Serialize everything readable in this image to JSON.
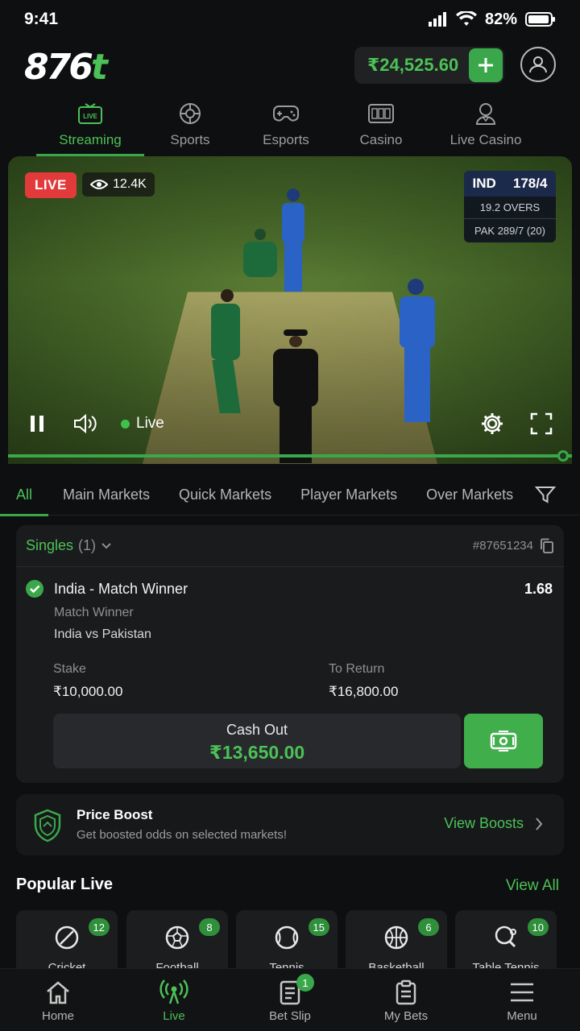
{
  "status_bar": {
    "time": "9:41",
    "battery": "82%"
  },
  "header": {
    "logo_main": "876",
    "logo_accent": "t",
    "balance": "₹24,525.60"
  },
  "top_tabs": [
    {
      "label": "Streaming",
      "icon": "live-tv-icon",
      "active": true
    },
    {
      "label": "Sports",
      "icon": "ball-icon"
    },
    {
      "label": "Esports",
      "icon": "gamepad-icon"
    },
    {
      "label": "Casino",
      "icon": "slot-machine-icon"
    },
    {
      "label": "Live Casino",
      "icon": "dealer-icon"
    }
  ],
  "video": {
    "live_badge": "LIVE",
    "viewers": "12.4K",
    "score": {
      "team": "IND",
      "runs": "178/4",
      "overs": "19.2 OVERS",
      "opponent": "PAK 289/7 (20)"
    },
    "live_label": "Live",
    "progress": 0.98
  },
  "market_tabs": [
    "All",
    "Main Markets",
    "Quick Markets",
    "Player Markets",
    "Over Markets"
  ],
  "bet": {
    "singles_label": "Singles",
    "singles_count": "(1)",
    "bet_id": "#87651234",
    "selection": "India - Match Winner",
    "odds": "1.68",
    "market": "Match Winner",
    "match": "India vs Pakistan",
    "stake_label": "Stake",
    "stake": "₹10,000.00",
    "return_label": "To Return",
    "return": "₹16,800.00",
    "cashout_label": "Cash Out",
    "cashout_amount": "₹13,650.00"
  },
  "boost": {
    "title": "Price Boost",
    "subtitle": "Get boosted odds on selected markets!",
    "link": "View Boosts"
  },
  "popular": {
    "title": "Popular Live",
    "view_all": "View All",
    "sports": [
      {
        "name": "Cricket",
        "count": "12"
      },
      {
        "name": "Football",
        "count": "8"
      },
      {
        "name": "Tennis",
        "count": "15"
      },
      {
        "name": "Basketball",
        "count": "6"
      },
      {
        "name": "Table Tennis",
        "count": "10"
      }
    ]
  },
  "bottom_nav": [
    {
      "label": "Home"
    },
    {
      "label": "Live",
      "active": true
    },
    {
      "label": "Bet Slip",
      "badge": "1"
    },
    {
      "label": "My Bets"
    },
    {
      "label": "Menu"
    }
  ],
  "colors": {
    "accent": "#4cc157",
    "live_red": "#e23a3a",
    "background": "#0e0f10"
  }
}
